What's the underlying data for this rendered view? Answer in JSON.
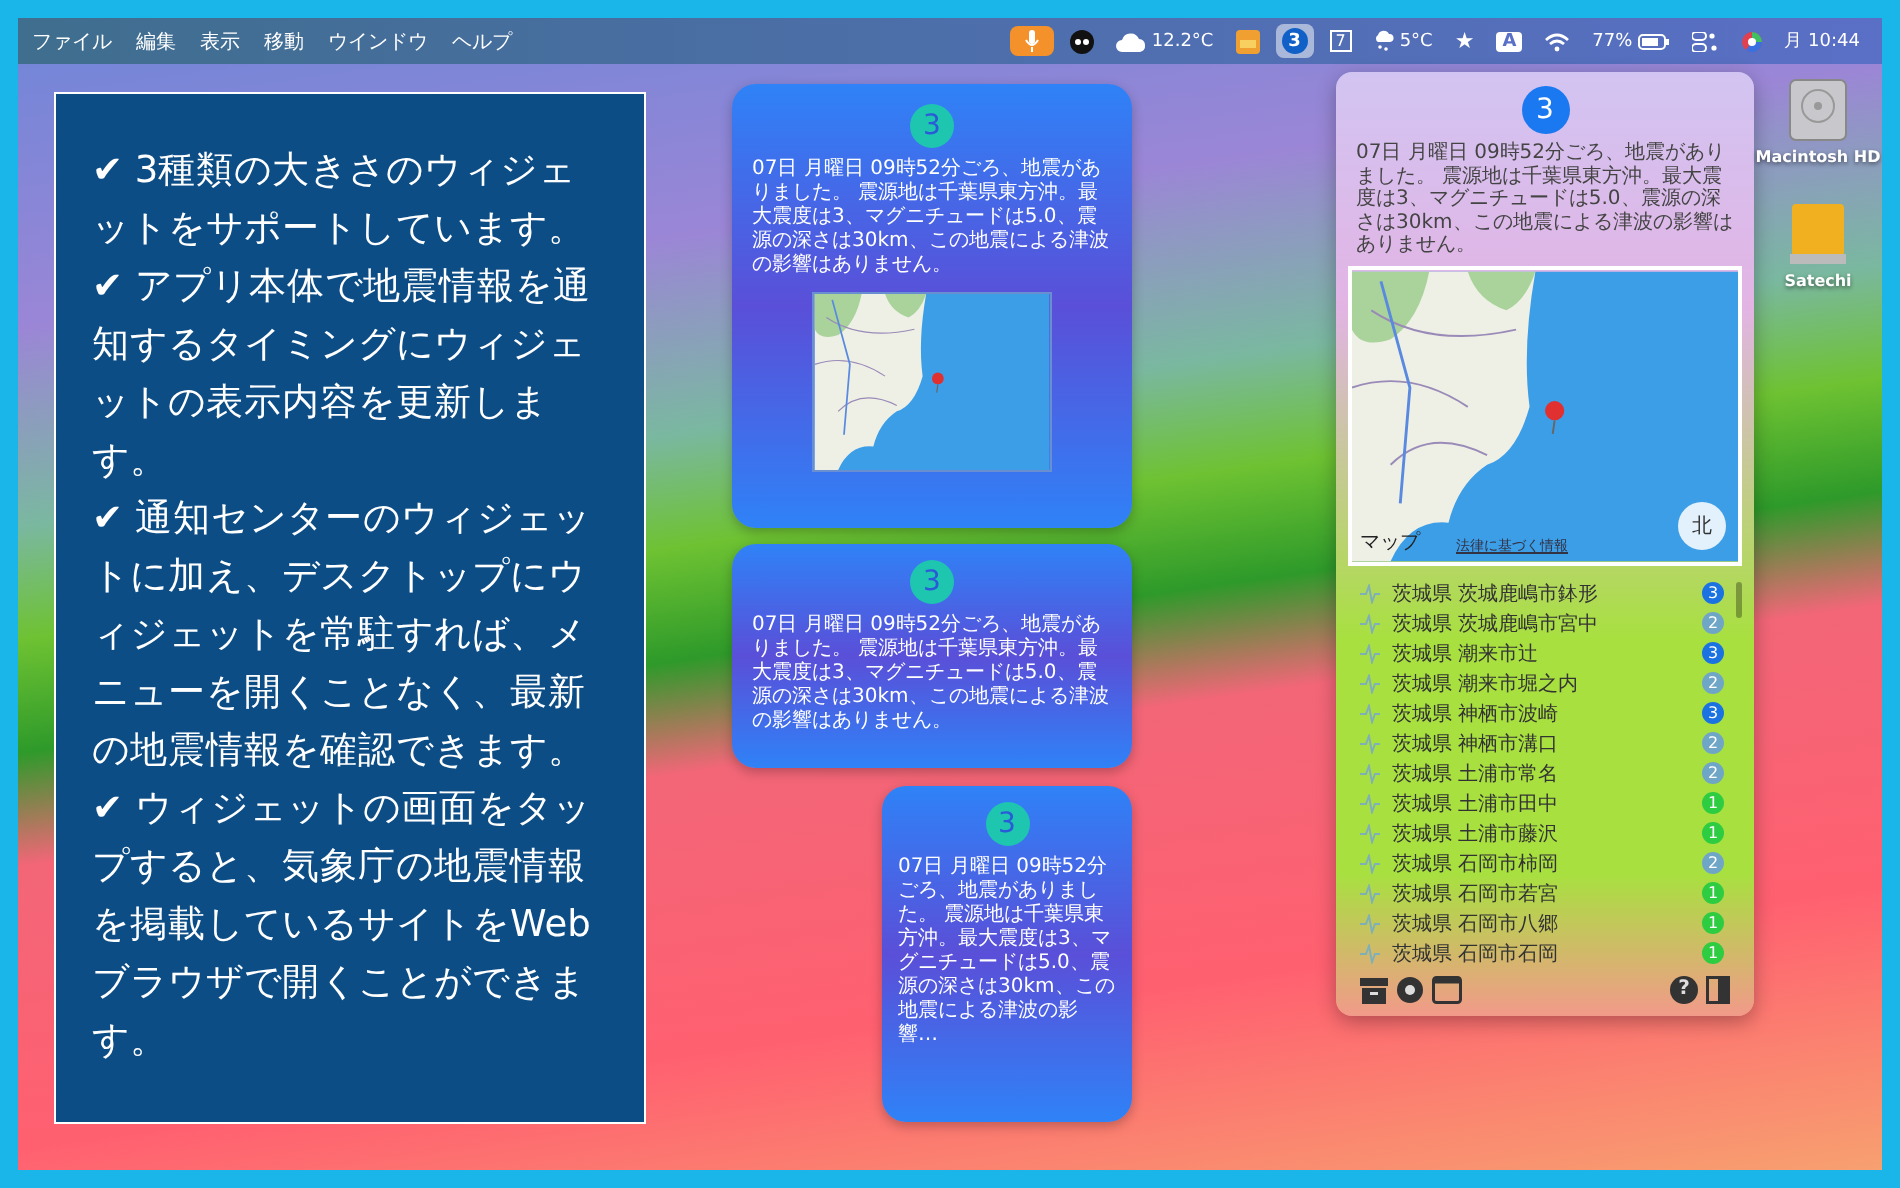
{
  "menu_bar": {
    "menus": [
      {
        "label": "ファイル"
      },
      {
        "label": "編集"
      },
      {
        "label": "表示"
      },
      {
        "label": "移動"
      },
      {
        "label": "ウインドウ"
      },
      {
        "label": "ヘルプ"
      }
    ],
    "status_items": [
      {
        "kind": "mic",
        "selected": false
      },
      {
        "kind": "app",
        "selected": false
      },
      {
        "kind": "cloud",
        "text": "12.2°C",
        "selected": false
      },
      {
        "kind": "folder",
        "selected": false
      },
      {
        "kind": "badge",
        "text": "3",
        "selected": true
      },
      {
        "kind": "calendar",
        "text": "7",
        "selected": false
      },
      {
        "kind": "snow",
        "text": "5°C",
        "selected": false
      },
      {
        "kind": "star",
        "text": "★",
        "selected": false
      },
      {
        "kind": "input",
        "text": "A",
        "selected": false
      },
      {
        "kind": "wifi",
        "selected": false
      },
      {
        "kind": "battery",
        "text": "77%",
        "selected": false
      },
      {
        "kind": "control",
        "selected": false
      },
      {
        "kind": "color",
        "selected": false
      },
      {
        "kind": "clock",
        "text": "月 10:44",
        "selected": false
      }
    ]
  },
  "promo_text": {
    "paragraphs": [
      "✔ 3種類の大きさのウィジェットをサポートしています。",
      "✔ アプリ本体で地震情報を通知するタイミングにウィジェットの表示内容を更新します。",
      "✔ 通知センターのウィジェットに加え、デスクトップにウィジェットを常駐すれば、メニューを開くことなく、最新の地震情報を確認できます。",
      "✔ ウィジェットの画面をタップすると、気象庁の地震情報を掲載しているサイトをWebブラウザで開くことができます。"
    ]
  },
  "widgets": [
    {
      "kind": "large",
      "badge": "3",
      "text": "07日 月曜日 09時52分ごろ、地震がありました。 震源地は千葉県東方沖。最大震度は3、マグニチュードは5.0、震源の深さは30km、この地震による津波の影響はありません。"
    },
    {
      "kind": "medium",
      "badge": "3",
      "text": "07日 月曜日 09時52分ごろ、地震がありました。 震源地は千葉県東方沖。最大震度は3、マグニチュードは5.0、震源の深さは30km、この地震による津波の影響はありません。"
    },
    {
      "kind": "small",
      "badge": "3",
      "text": "07日 月曜日 09時52分ごろ、地震がありました。 震源地は千葉県東方沖。最大震度は3、マグニチュードは5.0、震源の深さは30km、この地震による津波の影響…"
    }
  ],
  "popover": {
    "badge": "3",
    "text": "07日 月曜日 09時52分ごろ、地震がありました。 震源地は千葉県東方沖。最大震度は3、マグニチュードは5.0、震源の深さは30km、この地震による津波の影響はありません。",
    "map": {
      "attribution": "マップ",
      "legal_link": "法律に基づく情報",
      "compass": "北"
    },
    "locations": [
      {
        "name": "茨城県 茨城鹿嶋市鉢形",
        "intensity": "3",
        "color": "#1a73e0"
      },
      {
        "name": "茨城県 茨城鹿嶋市宮中",
        "intensity": "2",
        "color": "#6fa6c6"
      },
      {
        "name": "茨城県 潮来市辻",
        "intensity": "3",
        "color": "#1a73e0"
      },
      {
        "name": "茨城県 潮来市堀之内",
        "intensity": "2",
        "color": "#6fa6c6"
      },
      {
        "name": "茨城県 神栖市波崎",
        "intensity": "3",
        "color": "#1a73e0"
      },
      {
        "name": "茨城県 神栖市溝口",
        "intensity": "2",
        "color": "#6fa6c6"
      },
      {
        "name": "茨城県 土浦市常名",
        "intensity": "2",
        "color": "#6fa6c6"
      },
      {
        "name": "茨城県 土浦市田中",
        "intensity": "1",
        "color": "#2ecc40"
      },
      {
        "name": "茨城県 土浦市藤沢",
        "intensity": "1",
        "color": "#2ecc40"
      },
      {
        "name": "茨城県 石岡市柿岡",
        "intensity": "2",
        "color": "#6fa6c6"
      },
      {
        "name": "茨城県 石岡市若宮",
        "intensity": "1",
        "color": "#2ecc40"
      },
      {
        "name": "茨城県 石岡市八郷",
        "intensity": "1",
        "color": "#2ecc40"
      },
      {
        "name": "茨城県 石岡市石岡",
        "intensity": "1",
        "color": "#2ecc40"
      }
    ],
    "footer": [
      {
        "kind": "archive"
      },
      {
        "kind": "gear"
      },
      {
        "kind": "window"
      },
      {
        "kind": "help",
        "text": "?"
      },
      {
        "kind": "door"
      }
    ]
  },
  "desktop_icons": [
    {
      "kind": "disk",
      "label": "Macintosh HD"
    },
    {
      "kind": "drive",
      "label": "Satechi"
    }
  ]
}
